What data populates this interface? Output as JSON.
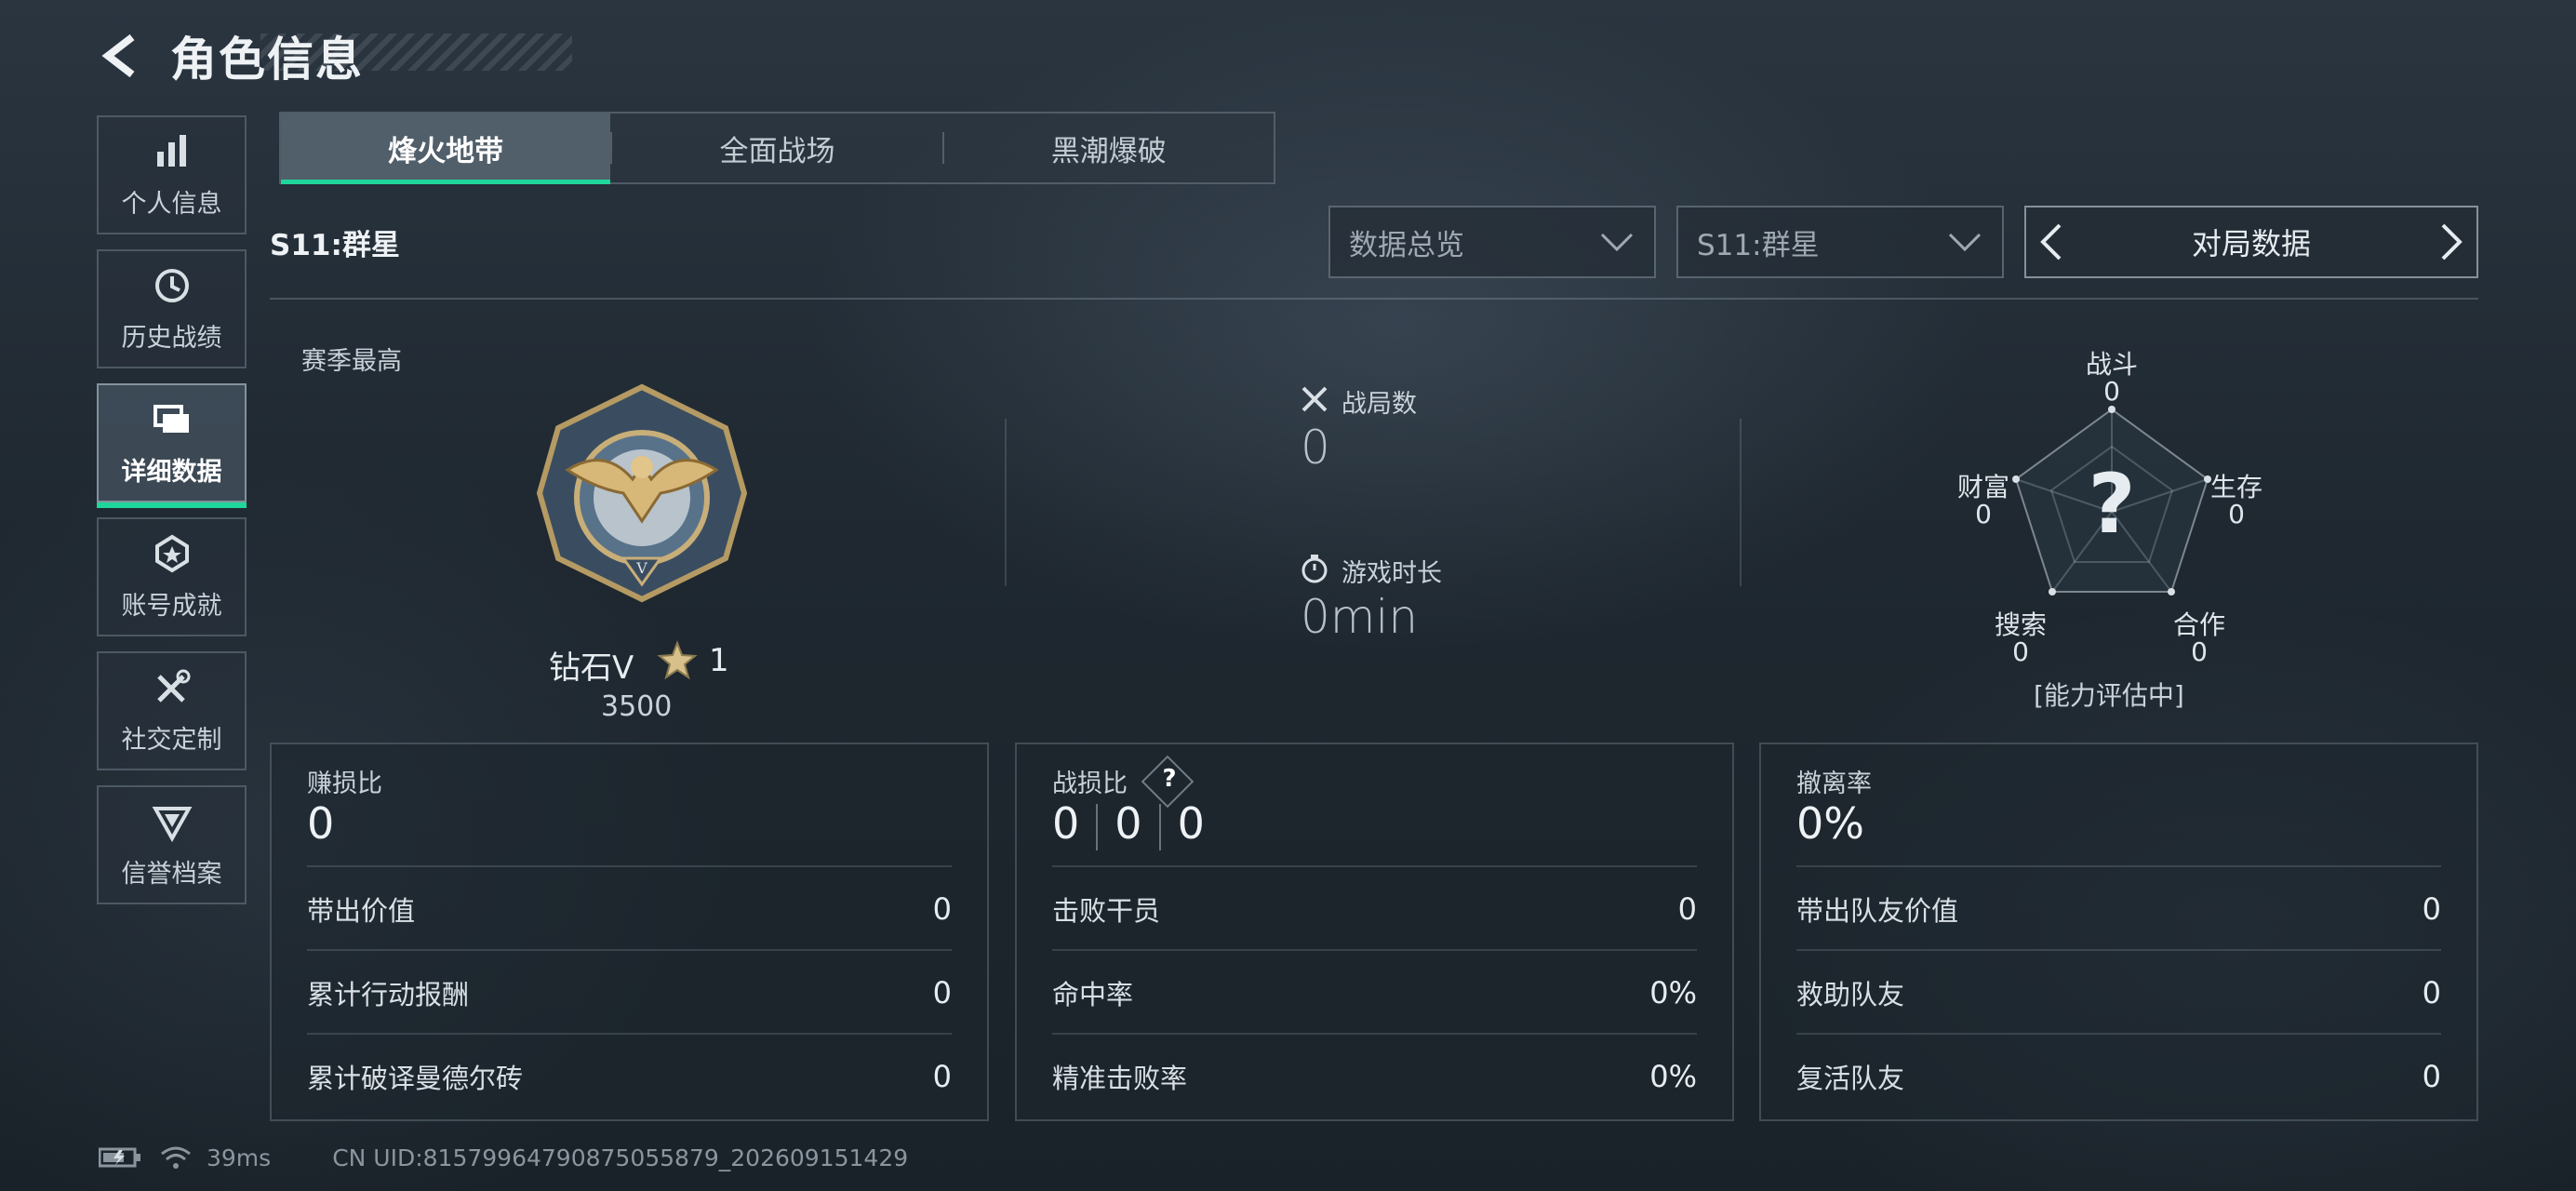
{
  "header": {
    "title": "角色信息"
  },
  "sidebar": {
    "items": [
      {
        "label": "个人信息",
        "icon": "bar-chart-icon"
      },
      {
        "label": "历史战绩",
        "icon": "history-clock-icon"
      },
      {
        "label": "详细数据",
        "icon": "folders-icon",
        "active": true
      },
      {
        "label": "账号成就",
        "icon": "achievement-medal-icon"
      },
      {
        "label": "社交定制",
        "icon": "tools-icon"
      },
      {
        "label": "信誉档案",
        "icon": "shield-emblem-icon"
      }
    ]
  },
  "tabs": [
    {
      "label": "烽火地带",
      "active": true
    },
    {
      "label": "全面战场"
    },
    {
      "label": "黑潮爆破"
    }
  ],
  "season": {
    "label": "S11:群星"
  },
  "filters": {
    "overview": "数据总览",
    "season": "S11:群星",
    "pager_label": "对局数据"
  },
  "rank": {
    "title": "赛季最高",
    "name": "钻石V",
    "stars": "1",
    "score": "3500"
  },
  "summary": {
    "matches_label": "战局数",
    "matches_value": "0",
    "playtime_label": "游戏时长",
    "playtime_value": "0min"
  },
  "radar": {
    "center": "?",
    "combat_label": "战斗",
    "combat_value": "0",
    "survival_label": "生存",
    "survival_value": "0",
    "teamwork_label": "合作",
    "teamwork_value": "0",
    "search_label": "搜索",
    "search_value": "0",
    "wealth_label": "财富",
    "wealth_value": "0",
    "note": "[能力评估中]"
  },
  "cards": {
    "profit": {
      "label": "赚损比",
      "value": "0",
      "rows": [
        {
          "label": "带出价值",
          "value": "0"
        },
        {
          "label": "累计行动报酬",
          "value": "0"
        },
        {
          "label": "累计破译曼德尔砖",
          "value": "0"
        }
      ]
    },
    "kd": {
      "label": "战损比",
      "help": "?",
      "values": [
        "0",
        "0",
        "0"
      ],
      "rows": [
        {
          "label": "击败干员",
          "value": "0"
        },
        {
          "label": "命中率",
          "value": "0%"
        },
        {
          "label": "精准击败率",
          "value": "0%"
        }
      ]
    },
    "extract": {
      "label": "撤离率",
      "value": "0%",
      "rows": [
        {
          "label": "带出队友价值",
          "value": "0"
        },
        {
          "label": "救助队友",
          "value": "0"
        },
        {
          "label": "复活队友",
          "value": "0"
        }
      ]
    }
  },
  "footer": {
    "ping": "39ms",
    "uid": "CN UID:8157996479087505587​9_202609151429"
  },
  "colors": {
    "accent": "#1fd69b",
    "background": "#1f2830"
  }
}
